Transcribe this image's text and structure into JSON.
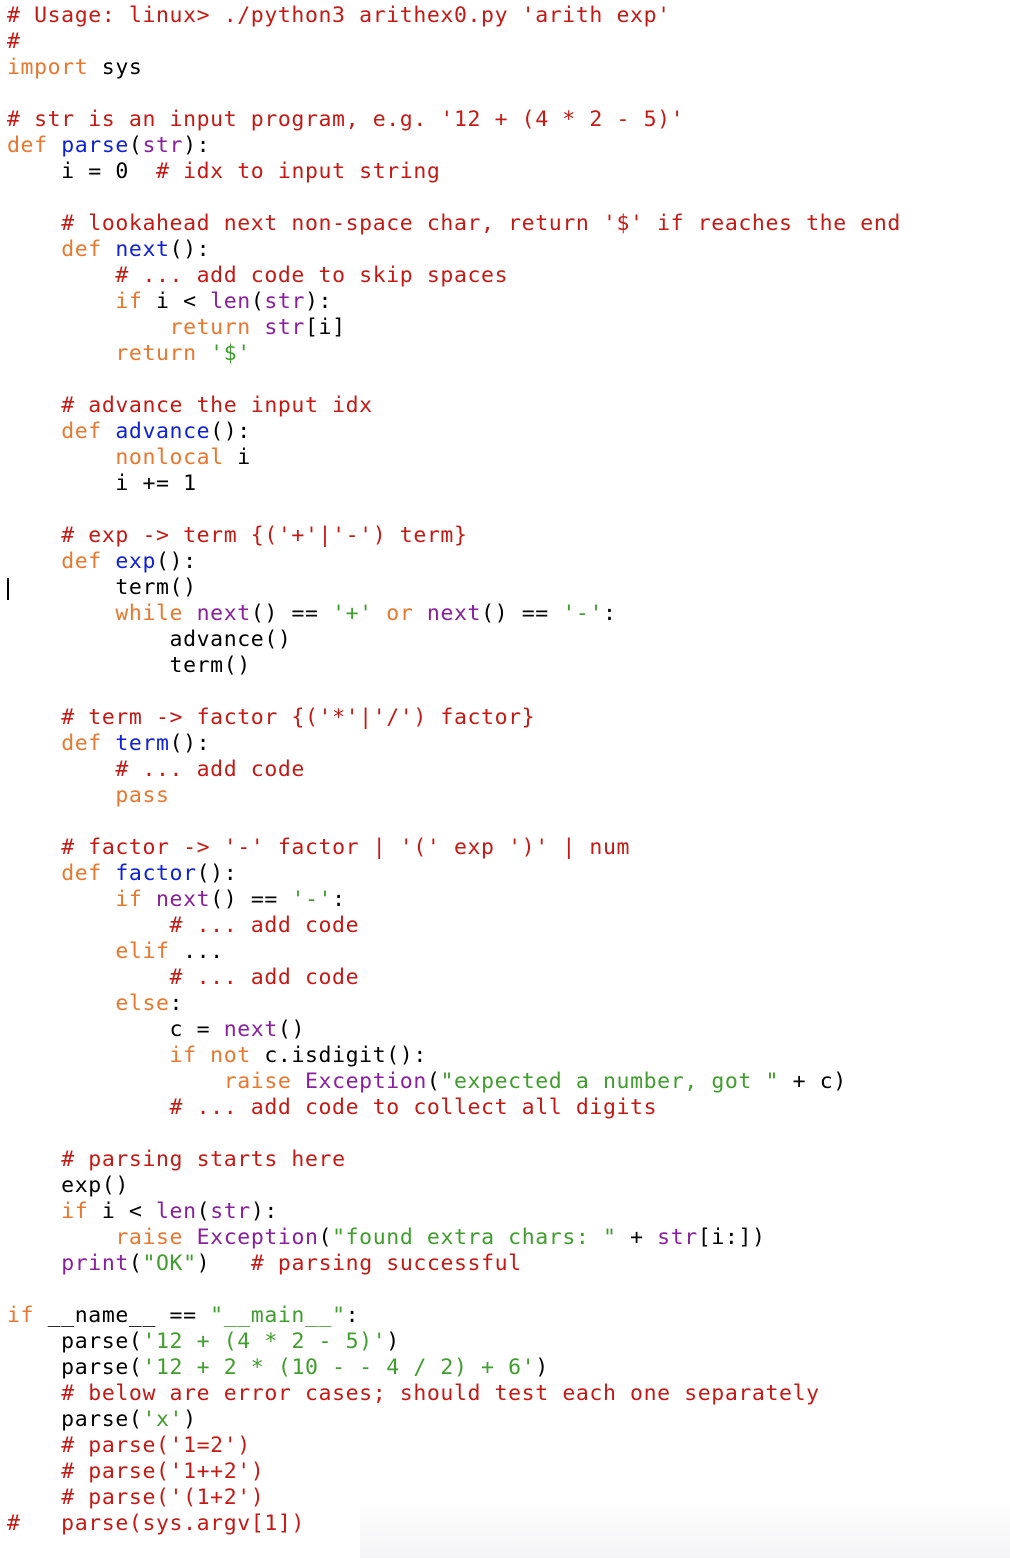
{
  "editor": {
    "language": "python",
    "cursor_line": 23,
    "colors": {
      "comment": "#c41a16",
      "keyword": "#e8782f",
      "function_def": "#0f22d6",
      "builtin": "#8a1f9e",
      "string": "#3f9e2d",
      "text": "#000000"
    },
    "lines": [
      [
        [
          "cm",
          "# Usage: linux> ./python3 arithex0.py 'arith exp'"
        ]
      ],
      [
        [
          "cm",
          "#"
        ]
      ],
      [
        [
          "kw",
          "import"
        ],
        [
          "tx",
          " sys"
        ]
      ],
      [],
      [
        [
          "cm",
          "# str is an input program, e.g. '12 + (4 * 2 - 5)'"
        ]
      ],
      [
        [
          "kw",
          "def"
        ],
        [
          "tx",
          " "
        ],
        [
          "fn",
          "parse"
        ],
        [
          "tx",
          "("
        ],
        [
          "bi",
          "str"
        ],
        [
          "tx",
          "):"
        ]
      ],
      [
        [
          "tx",
          "    i = 0  "
        ],
        [
          "cm",
          "# idx to input string"
        ]
      ],
      [],
      [
        [
          "tx",
          "    "
        ],
        [
          "cm",
          "# lookahead next non-space char, return '$' if reaches the end"
        ]
      ],
      [
        [
          "tx",
          "    "
        ],
        [
          "kw",
          "def"
        ],
        [
          "tx",
          " "
        ],
        [
          "fn",
          "next"
        ],
        [
          "tx",
          "():"
        ]
      ],
      [
        [
          "tx",
          "        "
        ],
        [
          "cm",
          "# ... add code to skip spaces"
        ]
      ],
      [
        [
          "tx",
          "        "
        ],
        [
          "kw",
          "if"
        ],
        [
          "tx",
          " i < "
        ],
        [
          "bi",
          "len"
        ],
        [
          "tx",
          "("
        ],
        [
          "bi",
          "str"
        ],
        [
          "tx",
          "):"
        ]
      ],
      [
        [
          "tx",
          "            "
        ],
        [
          "kw",
          "return"
        ],
        [
          "tx",
          " "
        ],
        [
          "bi",
          "str"
        ],
        [
          "tx",
          "[i]"
        ]
      ],
      [
        [
          "tx",
          "        "
        ],
        [
          "kw",
          "return"
        ],
        [
          "tx",
          " "
        ],
        [
          "st",
          "'$'"
        ]
      ],
      [],
      [
        [
          "tx",
          "    "
        ],
        [
          "cm",
          "# advance the input idx"
        ]
      ],
      [
        [
          "tx",
          "    "
        ],
        [
          "kw",
          "def"
        ],
        [
          "tx",
          " "
        ],
        [
          "fn",
          "advance"
        ],
        [
          "tx",
          "():"
        ]
      ],
      [
        [
          "tx",
          "        "
        ],
        [
          "kw",
          "nonlocal"
        ],
        [
          "tx",
          " i"
        ]
      ],
      [
        [
          "tx",
          "        i += 1"
        ]
      ],
      [],
      [
        [
          "tx",
          "    "
        ],
        [
          "cm",
          "# exp -> term {('+'|'-') term}"
        ]
      ],
      [
        [
          "tx",
          "    "
        ],
        [
          "kw",
          "def"
        ],
        [
          "tx",
          " "
        ],
        [
          "fn",
          "exp"
        ],
        [
          "tx",
          "():"
        ]
      ],
      [
        [
          "tx",
          "        term()"
        ]
      ],
      [
        [
          "tx",
          "        "
        ],
        [
          "kw",
          "while"
        ],
        [
          "tx",
          " "
        ],
        [
          "bi",
          "next"
        ],
        [
          "tx",
          "() == "
        ],
        [
          "st",
          "'+'"
        ],
        [
          "tx",
          " "
        ],
        [
          "kw",
          "or"
        ],
        [
          "tx",
          " "
        ],
        [
          "bi",
          "next"
        ],
        [
          "tx",
          "() == "
        ],
        [
          "st",
          "'-'"
        ],
        [
          "tx",
          ":"
        ]
      ],
      [
        [
          "tx",
          "            advance()"
        ]
      ],
      [
        [
          "tx",
          "            term()"
        ]
      ],
      [],
      [
        [
          "tx",
          "    "
        ],
        [
          "cm",
          "# term -> factor {('*'|'/') factor}"
        ]
      ],
      [
        [
          "tx",
          "    "
        ],
        [
          "kw",
          "def"
        ],
        [
          "tx",
          " "
        ],
        [
          "fn",
          "term"
        ],
        [
          "tx",
          "():"
        ]
      ],
      [
        [
          "tx",
          "        "
        ],
        [
          "cm",
          "# ... add code"
        ]
      ],
      [
        [
          "tx",
          "        "
        ],
        [
          "kw",
          "pass"
        ]
      ],
      [],
      [
        [
          "tx",
          "    "
        ],
        [
          "cm",
          "# factor -> '-' factor | '(' exp ')' | num"
        ]
      ],
      [
        [
          "tx",
          "    "
        ],
        [
          "kw",
          "def"
        ],
        [
          "tx",
          " "
        ],
        [
          "fn",
          "factor"
        ],
        [
          "tx",
          "():"
        ]
      ],
      [
        [
          "tx",
          "        "
        ],
        [
          "kw",
          "if"
        ],
        [
          "tx",
          " "
        ],
        [
          "bi",
          "next"
        ],
        [
          "tx",
          "() == "
        ],
        [
          "st",
          "'-'"
        ],
        [
          "tx",
          ":"
        ]
      ],
      [
        [
          "tx",
          "            "
        ],
        [
          "cm",
          "# ... add code"
        ]
      ],
      [
        [
          "tx",
          "        "
        ],
        [
          "kw",
          "elif"
        ],
        [
          "tx",
          " ..."
        ]
      ],
      [
        [
          "tx",
          "            "
        ],
        [
          "cm",
          "# ... add code"
        ]
      ],
      [
        [
          "tx",
          "        "
        ],
        [
          "kw",
          "else"
        ],
        [
          "tx",
          ":"
        ]
      ],
      [
        [
          "tx",
          "            c = "
        ],
        [
          "bi",
          "next"
        ],
        [
          "tx",
          "()"
        ]
      ],
      [
        [
          "tx",
          "            "
        ],
        [
          "kw",
          "if"
        ],
        [
          "tx",
          " "
        ],
        [
          "kw",
          "not"
        ],
        [
          "tx",
          " c.isdigit():"
        ]
      ],
      [
        [
          "tx",
          "                "
        ],
        [
          "kw",
          "raise"
        ],
        [
          "tx",
          " "
        ],
        [
          "bi",
          "Exception"
        ],
        [
          "tx",
          "("
        ],
        [
          "st",
          "\"expected a number, got \""
        ],
        [
          "tx",
          " + c)"
        ]
      ],
      [
        [
          "tx",
          "            "
        ],
        [
          "cm",
          "# ... add code to collect all digits"
        ]
      ],
      [],
      [
        [
          "tx",
          "    "
        ],
        [
          "cm",
          "# parsing starts here"
        ]
      ],
      [
        [
          "tx",
          "    exp()"
        ]
      ],
      [
        [
          "tx",
          "    "
        ],
        [
          "kw",
          "if"
        ],
        [
          "tx",
          " i < "
        ],
        [
          "bi",
          "len"
        ],
        [
          "tx",
          "("
        ],
        [
          "bi",
          "str"
        ],
        [
          "tx",
          "):"
        ]
      ],
      [
        [
          "tx",
          "        "
        ],
        [
          "kw",
          "raise"
        ],
        [
          "tx",
          " "
        ],
        [
          "bi",
          "Exception"
        ],
        [
          "tx",
          "("
        ],
        [
          "st",
          "\"found extra chars: \""
        ],
        [
          "tx",
          " + "
        ],
        [
          "bi",
          "str"
        ],
        [
          "tx",
          "[i:])"
        ]
      ],
      [
        [
          "tx",
          "    "
        ],
        [
          "bi",
          "print"
        ],
        [
          "tx",
          "("
        ],
        [
          "st",
          "\"OK\""
        ],
        [
          "tx",
          ")   "
        ],
        [
          "cm",
          "# parsing successful"
        ]
      ],
      [],
      [
        [
          "kw",
          "if"
        ],
        [
          "tx",
          " __name__ == "
        ],
        [
          "st",
          "\"__main__\""
        ],
        [
          "tx",
          ":"
        ]
      ],
      [
        [
          "tx",
          "    parse("
        ],
        [
          "st",
          "'12 + (4 * 2 - 5)'"
        ],
        [
          "tx",
          ")"
        ]
      ],
      [
        [
          "tx",
          "    parse("
        ],
        [
          "st",
          "'12 + 2 * (10 - - 4 / 2) + 6'"
        ],
        [
          "tx",
          ")"
        ]
      ],
      [
        [
          "tx",
          "    "
        ],
        [
          "cm",
          "# below are error cases; should test each one separately"
        ]
      ],
      [
        [
          "tx",
          "    parse("
        ],
        [
          "st",
          "'x'"
        ],
        [
          "tx",
          ")"
        ]
      ],
      [
        [
          "tx",
          "    "
        ],
        [
          "cm",
          "# parse('1=2')"
        ]
      ],
      [
        [
          "tx",
          "    "
        ],
        [
          "cm",
          "# parse('1++2')"
        ]
      ],
      [
        [
          "tx",
          "    "
        ],
        [
          "cm",
          "# parse('(1+2')"
        ]
      ],
      [
        [
          "cm",
          "#   parse(sys.argv[1])"
        ]
      ]
    ]
  }
}
